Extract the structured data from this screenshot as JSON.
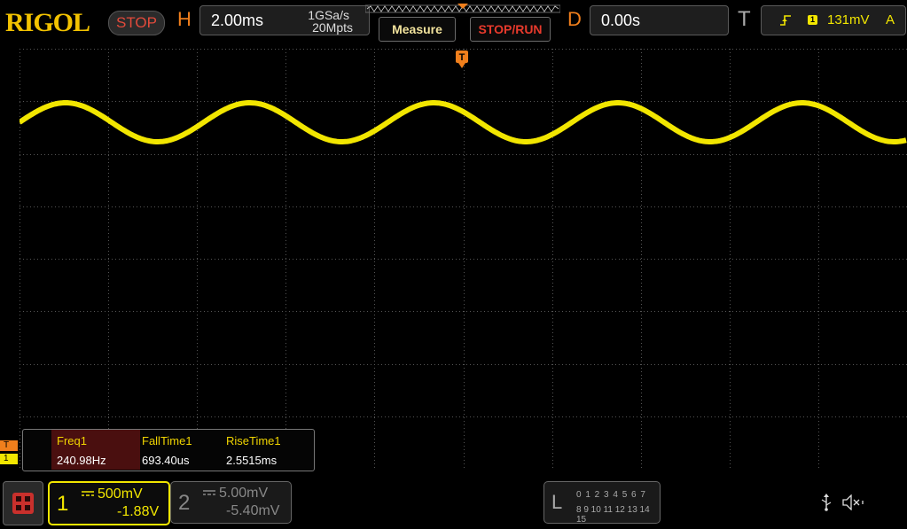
{
  "header": {
    "brand": "RIGOL",
    "run_state": "STOP",
    "horizontal": {
      "letter": "H",
      "timebase": "2.00ms",
      "sample_rate": "1GSa/s",
      "memory_depth": "20Mpts"
    },
    "measure_label": "Measure",
    "stoprun_label": "STOP/RUN",
    "delay": {
      "letter": "D",
      "value": "0.00s"
    },
    "trigger": {
      "letter": "T",
      "source": "1",
      "level": "131mV",
      "mode": "A"
    }
  },
  "measurements": {
    "columns": [
      {
        "label": "Freq1",
        "value": "240.98Hz"
      },
      {
        "label": "FallTime1",
        "value": "693.40us"
      },
      {
        "label": "RiseTime1",
        "value": "2.5515ms"
      }
    ]
  },
  "markers": {
    "trigger": "T",
    "channel1": "1"
  },
  "channels": {
    "ch1": {
      "number": "1",
      "scale": "500mV",
      "offset": "-1.88V",
      "color": "#f2e600"
    },
    "ch2": {
      "number": "2",
      "scale": "5.00mV",
      "offset": "-5.40mV",
      "color": "#888888"
    }
  },
  "logic": {
    "letter": "L",
    "row1": "0 1 2 3  4 5 6 7",
    "row2": "8 9 10 11 12 13 14 15"
  },
  "icons": [
    "menu-icon",
    "trigger-slope-icon",
    "usb-icon",
    "speaker-muted-icon",
    "trigger-position-icon"
  ],
  "waveform": {
    "frequency_hz": 240.98,
    "timebase_ms_per_div": 2.0,
    "color": "#f2e600"
  },
  "colors": {
    "accent": "#f07f1c",
    "brand": "#f2c200",
    "stop": "#e24a3b",
    "channel1": "#f2e600"
  }
}
